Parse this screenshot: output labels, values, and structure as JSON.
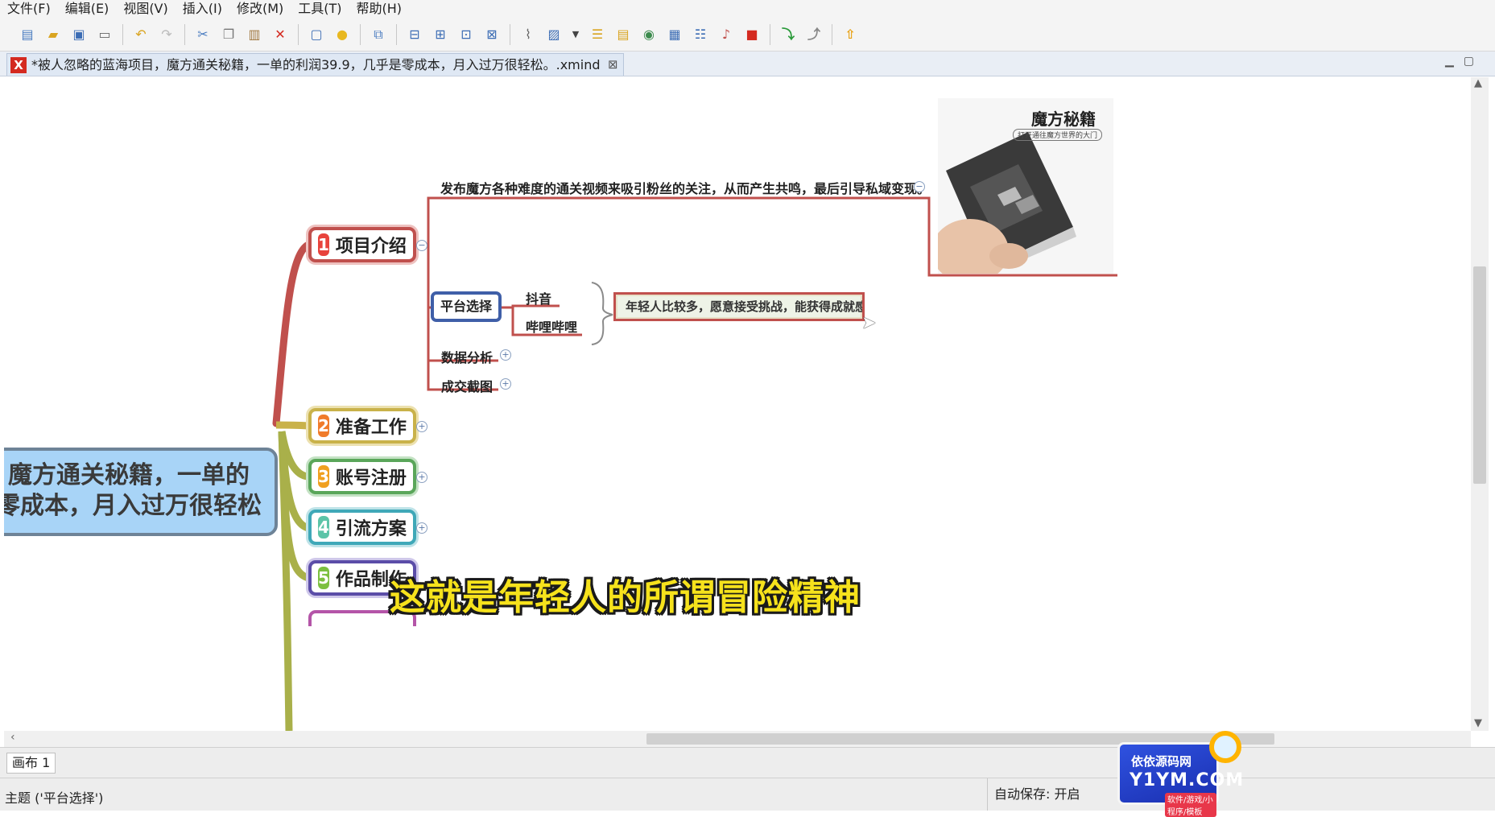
{
  "menubar": {
    "items": [
      "文件(F)",
      "编辑(E)",
      "视图(V)",
      "插入(I)",
      "修改(M)",
      "工具(T)",
      "帮助(H)"
    ]
  },
  "toolbar": {
    "icons": [
      "new-file-icon",
      "open-folder-icon",
      "save-icon",
      "print-icon",
      "undo-icon",
      "redo-icon",
      "cut-icon",
      "copy-icon",
      "paste-icon",
      "delete-icon",
      "comment-icon",
      "lightbulb-icon",
      "relationship-icon",
      "insert-topic-icon",
      "insert-subtopic-icon",
      "insert-before-icon",
      "insert-parent-icon",
      "attachment-icon",
      "image-icon",
      "dropdown-icon",
      "boundary-icon",
      "note-icon",
      "globe-icon",
      "label-icon",
      "summary-icon",
      "relationship-link-icon",
      "stop-icon",
      "drill-down-icon",
      "drill-up-icon",
      "home-icon"
    ]
  },
  "tab": {
    "title": "*被人忽略的蓝海项目，魔方通关秘籍，一单的利润39.9，几乎是零成本，月入过万很轻松。.xmind",
    "icon_letter": "X",
    "close_glyph": "⊠"
  },
  "mindmap": {
    "central": {
      "line1": "魔方通关秘籍，一单的",
      "line2": "零成本，月入过万很轻松",
      "fill": "#a8d4f7"
    },
    "topics": [
      {
        "num": "1",
        "label": "项目介绍",
        "num_color": "#e8433c",
        "border": "#c0504d"
      },
      {
        "num": "2",
        "label": "准备工作",
        "num_color": "#f07b2b",
        "border": "#c9b24a"
      },
      {
        "num": "3",
        "label": "账号注册",
        "num_color": "#f0a020",
        "border": "#5aa65a"
      },
      {
        "num": "4",
        "label": "引流方案",
        "num_color": "#5cc4a8",
        "border": "#3fa8b8"
      },
      {
        "num": "5",
        "label": "作品制作",
        "num_color": "#7cc040",
        "border": "#5b4da8"
      }
    ],
    "intro_text": "发布魔方各种难度的通关视频来吸引粉丝的关注，从而产生共鸣，最后引导私域变现。",
    "platform": {
      "label": "平台选择",
      "children": [
        "抖音",
        "哔哩哔哩"
      ],
      "summary": "年轻人比较多，愿意接受挑战，能获得成就感。"
    },
    "subtopics": [
      "数据分析",
      "成交截图"
    ],
    "book_image": {
      "title": "魔方秘籍",
      "subtitle": "打开通往魔方世界的大门"
    }
  },
  "video_subtitle": "这就是年轻人的所谓冒险精神",
  "sheet": {
    "tab_label": "画布 1"
  },
  "statusbar": {
    "topic": "主题 ('平台选择')",
    "autosave": "自动保存: 开启"
  },
  "watermark": {
    "line1": "依依源码网",
    "line2": "Y1YM.COM",
    "line3": "软件/游戏/小程序/模板"
  }
}
